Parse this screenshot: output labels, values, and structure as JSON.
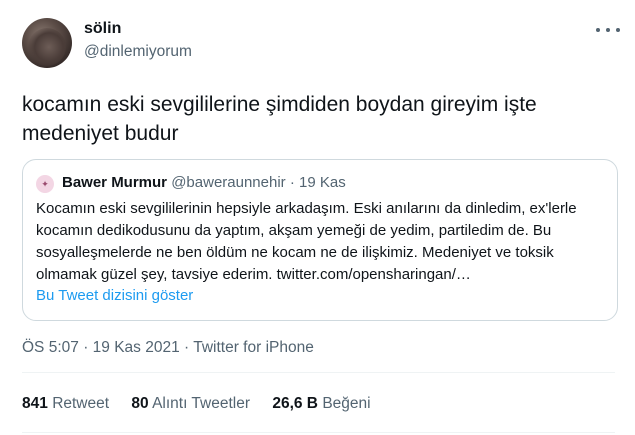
{
  "author": {
    "name": "sölin",
    "handle": "@dinlemiyorum"
  },
  "tweet_text": "kocamın eski sevgililerine şimdiden boydan gireyim işte medeniyet budur",
  "quote": {
    "name": "Bawer Murmur",
    "handle": "@baweraunnehir",
    "separator": "·",
    "date": "19 Kas",
    "text": "Kocamın eski sevgililerinin hepsiyle arkadaşım. Eski anılarını da dinledim, ex'lerle kocamın dedikodusunu da yaptım, akşam yemeği de yedim, partiledim de. Bu sosyalleşmelerde ne ben öldüm ne kocam ne de ilişkimiz. Medeniyet ve toksik olmamak güzel şey, tavsiye ederim. twitter.com/opensharingan/…",
    "show_thread_label": "Bu Tweet dizisini göster"
  },
  "meta": {
    "time": "ÖS 5:07",
    "separator": "·",
    "date": "19 Kas 2021",
    "source": "Twitter for iPhone"
  },
  "stats": {
    "retweets_count": "841",
    "retweets_label": "Retweet",
    "quotes_count": "80",
    "quotes_label": "Alıntı Tweetler",
    "likes_count": "26,6 B",
    "likes_label": "Beğeni"
  },
  "icons": {
    "more": "more-horizontal-icon"
  }
}
